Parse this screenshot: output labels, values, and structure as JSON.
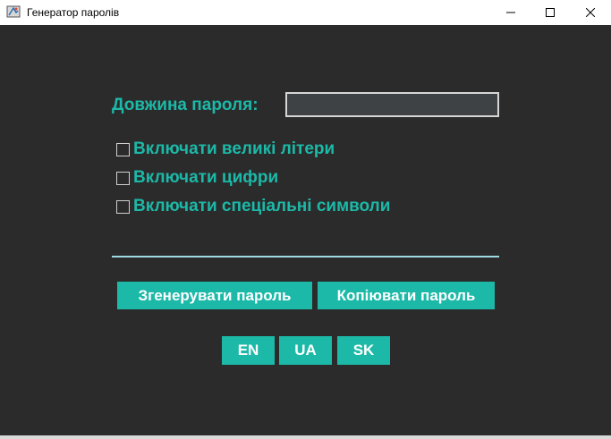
{
  "window": {
    "title": "Генератор паролів",
    "controls": [
      "minimize-icon",
      "maximize-icon",
      "close-icon"
    ]
  },
  "form": {
    "length_label": "Довжина пароля:",
    "length_value": "",
    "options": [
      {
        "label": "Включати великі літери",
        "checked": false
      },
      {
        "label": "Включати цифри",
        "checked": false
      },
      {
        "label": "Включати спеціальні символи",
        "checked": false
      }
    ],
    "output_value": ""
  },
  "actions": {
    "generate_label": "Згенерувати пароль",
    "copy_label": "Копіювати пароль"
  },
  "languages": [
    "EN",
    "UA",
    "SK"
  ],
  "colors": {
    "background": "#2b2b2b",
    "accent": "#1cb9a8",
    "input_bg": "#3e4245",
    "output_line": "#9fd9e2"
  }
}
